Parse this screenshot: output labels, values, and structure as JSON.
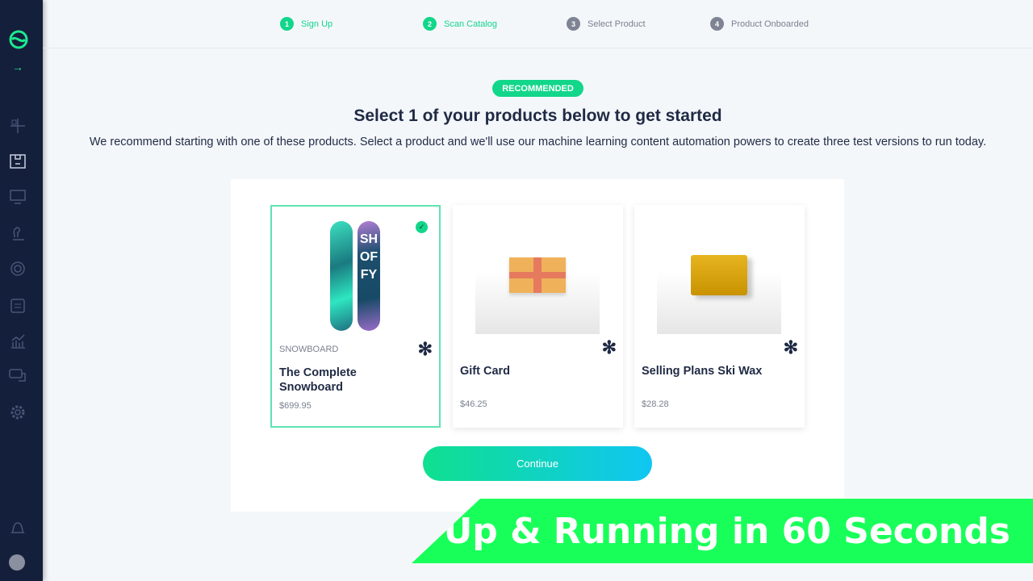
{
  "sidebar": {
    "icons": [
      "logo-icon",
      "arrow-right-icon",
      "tests-icon",
      "products-icon",
      "display-icon",
      "chess-icon",
      "target-icon",
      "clipboard-icon",
      "analytics-icon",
      "chat-icon",
      "gear-icon",
      "bell-icon",
      "avatar"
    ],
    "accent": "#1ee88f"
  },
  "steps": [
    {
      "num": "1",
      "label": "Sign Up",
      "state": "done"
    },
    {
      "num": "2",
      "label": "Scan Catalog",
      "state": "done"
    },
    {
      "num": "3",
      "label": "Select Product",
      "state": "pending"
    },
    {
      "num": "4",
      "label": "Product Onboarded",
      "state": "pending"
    }
  ],
  "badge": "RECOMMENDED",
  "title": "Select 1 of your products below to get started",
  "subtitle": "We recommend starting with one of these products. Select a product and we'll use our machine learning content automation powers to create three test versions to run today.",
  "products": [
    {
      "category": "SNOWBOARD",
      "name": "The Complete Snowboard",
      "price": "$699.95",
      "selected": true,
      "image_text": "SHOFFY"
    },
    {
      "category": "",
      "name": "Gift Card",
      "price": "$46.25",
      "selected": false
    },
    {
      "category": "",
      "name": "Selling Plans Ski Wax",
      "price": "$28.28",
      "selected": false
    }
  ],
  "continue_label": "Continue",
  "banner": "Up & Running in 60 Seconds"
}
